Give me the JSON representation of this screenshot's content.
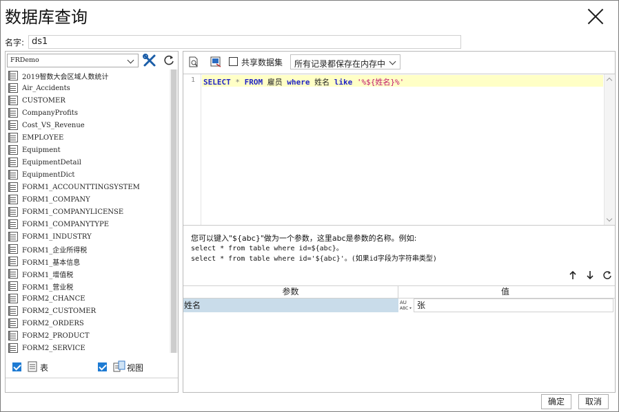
{
  "dialog": {
    "title": "数据库查询",
    "close_icon": "close-icon"
  },
  "name": {
    "label": "名字:",
    "value": "ds1"
  },
  "left": {
    "datasource": "FRDemo",
    "tables": [
      "2019智数大会区域人数统计",
      "Air_Accidents",
      "CUSTOMER",
      "CompanyProfits",
      "Cost_VS_Revenue",
      "EMPLOYEE",
      "Equipment",
      "EquipmentDetail",
      "EquipmentDict",
      "FORM1_ACCOUNTTINGSYSTEM",
      "FORM1_COMPANY",
      "FORM1_COMPANYLICENSE",
      "FORM1_COMPANYTYPE",
      "FORM1_INDUSTRY",
      "FORM1_企业所得税",
      "FORM1_基本信息",
      "FORM1_增值税",
      "FORM1_营业税",
      "FORM2_CHANCE",
      "FORM2_CUSTOMER",
      "FORM2_ORDERS",
      "FORM2_PRODUCT",
      "FORM2_SERVICE"
    ],
    "table_checkbox_label": "表",
    "view_checkbox_label": "视图"
  },
  "toolbar": {
    "share_label": "共享数据集",
    "memory_option": "所有记录都保存在内存中"
  },
  "editor": {
    "line_number": "1",
    "sql_select": "SELECT",
    "sql_star": "*",
    "sql_from": "FROM",
    "sql_table": "雇员",
    "sql_where": "where",
    "sql_field": "姓名",
    "sql_like": "like",
    "sql_string": "'%${姓名}%'"
  },
  "hint": {
    "line1": "您可以键入\"${abc}\"做为一个参数，这里abc是参数的名称。例如:",
    "line2": "select * from table where id=${abc}。",
    "line3": "select * from table where id='${abc}'。(如果id字段为字符串类型)"
  },
  "params": {
    "col_param": "参数",
    "col_value": "值",
    "rows": [
      {
        "name": "姓名",
        "value": "张"
      }
    ]
  },
  "buttons": {
    "ok": "确定",
    "cancel": "取消"
  }
}
